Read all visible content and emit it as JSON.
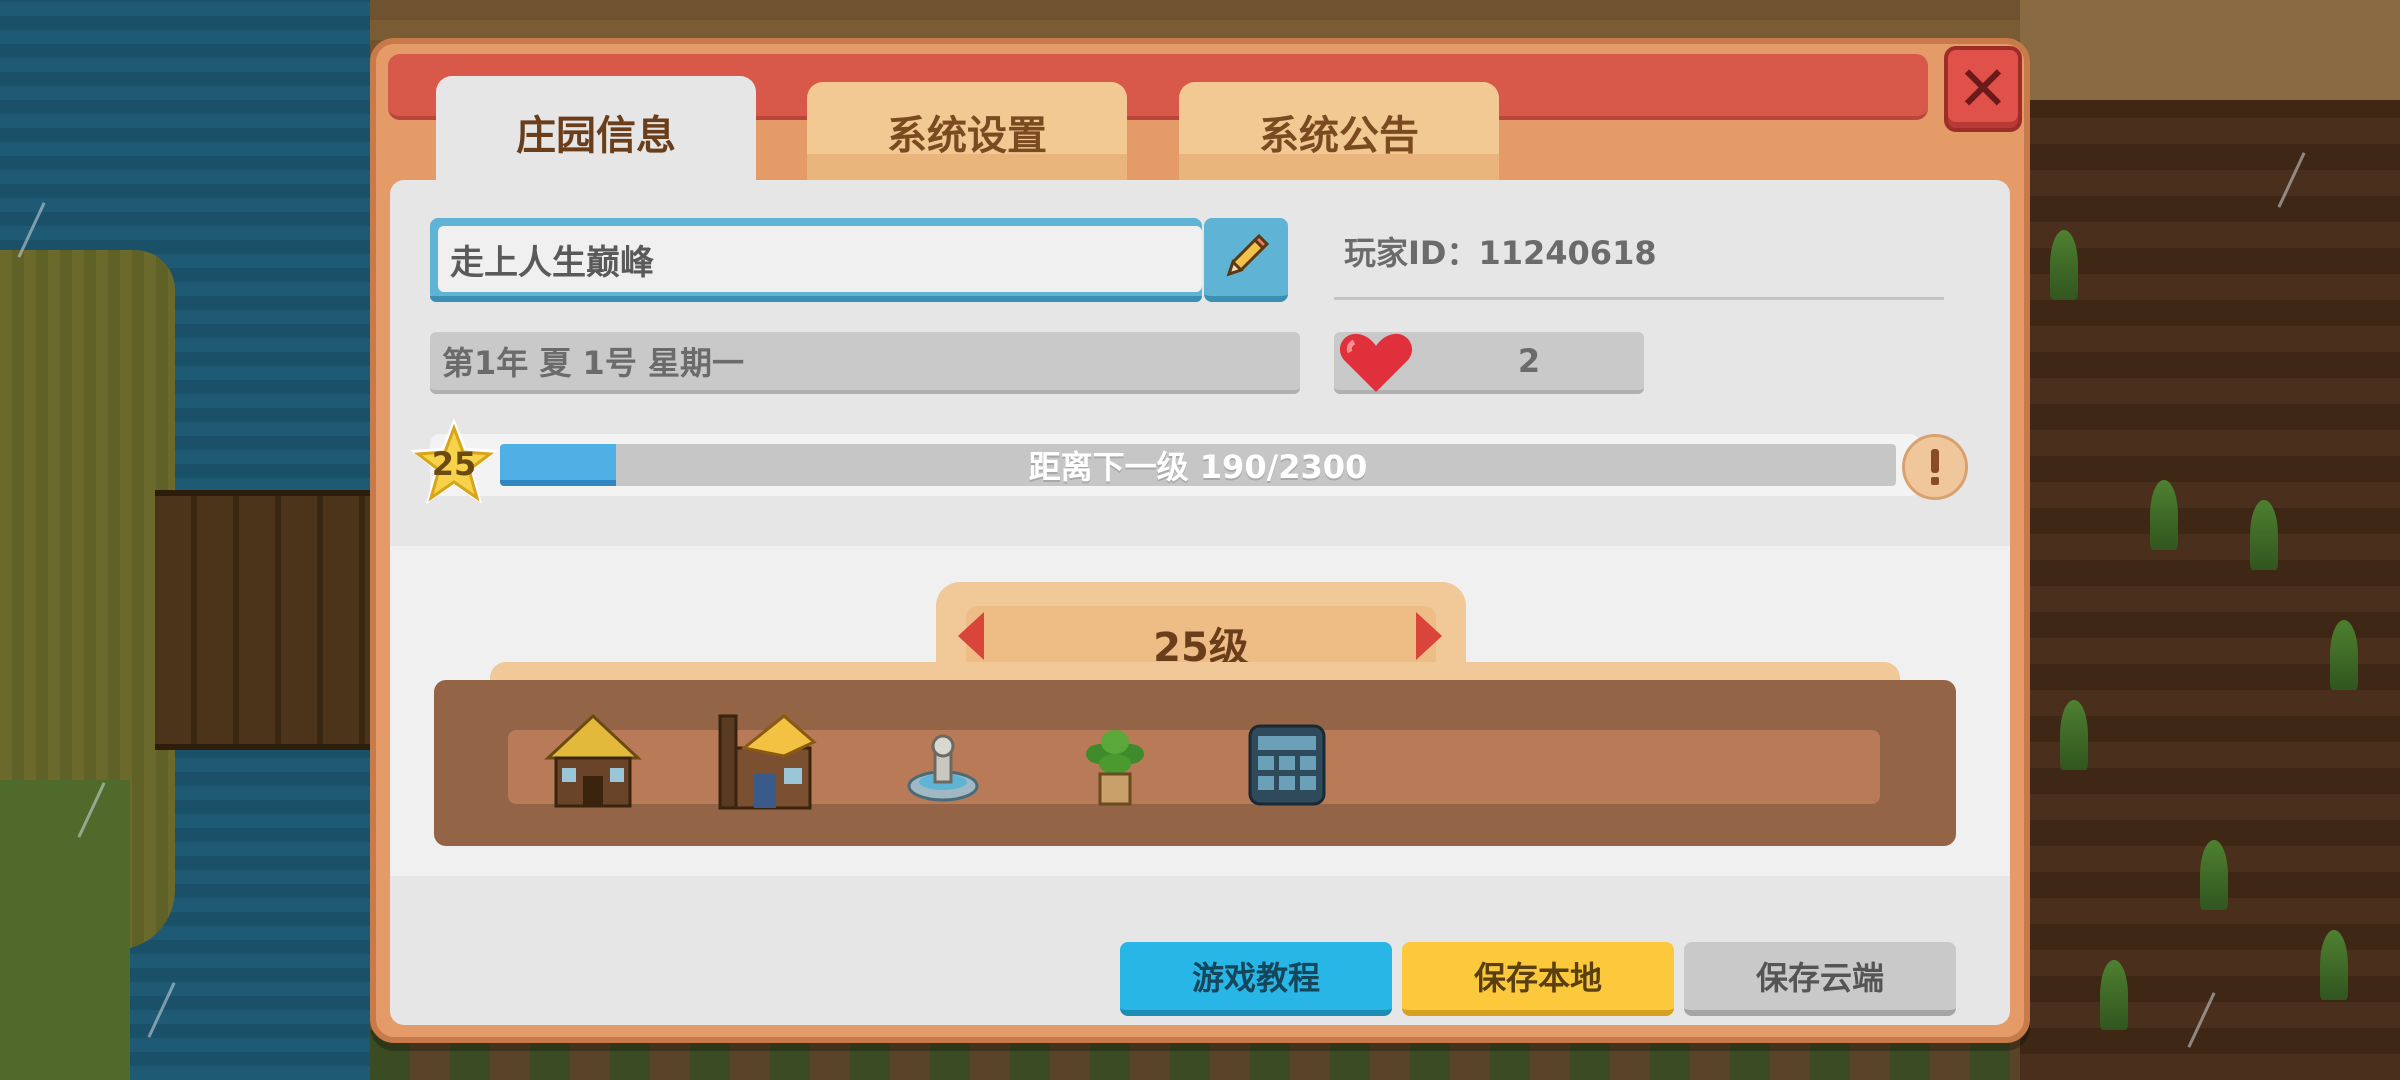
{
  "dialog": {
    "tabs": [
      {
        "label": "庄园信息",
        "active": true
      },
      {
        "label": "系统设置",
        "active": false
      },
      {
        "label": "系统公告",
        "active": false
      }
    ],
    "close_icon": "close-x-icon"
  },
  "profile": {
    "name_value": "走上人生巅峰",
    "edit_icon": "pencil-icon",
    "player_id": "玩家ID：11240618",
    "date_text": "第1年  夏  1号 星期一",
    "hearts": "2",
    "heart_icon": "heart-icon"
  },
  "level": {
    "current": "25",
    "progress_text": "距离下一级   190/2300",
    "progress_fraction": 0.083,
    "star_icon": "star-icon",
    "info_icon": "exclamation-icon"
  },
  "unlocks": {
    "level_label": "25级",
    "prev_icon": "arrow-left-icon",
    "next_icon": "arrow-right-icon",
    "items": [
      {
        "name": "thatched-cabin-icon"
      },
      {
        "name": "cheese-workshop-icon"
      },
      {
        "name": "stone-fountain-icon"
      },
      {
        "name": "potted-plant-icon"
      },
      {
        "name": "storage-cabinet-icon"
      }
    ]
  },
  "buttons": {
    "tutorial": "游戏教程",
    "save_local": "保存本地",
    "save_cloud": "保存云端"
  },
  "colors": {
    "tutorial": "#28b6e6",
    "save_local": "#fdc93c",
    "save_cloud": "#c9c9c9",
    "title_bar": "#d8584a",
    "progress_fill": "#4fb0e6"
  }
}
